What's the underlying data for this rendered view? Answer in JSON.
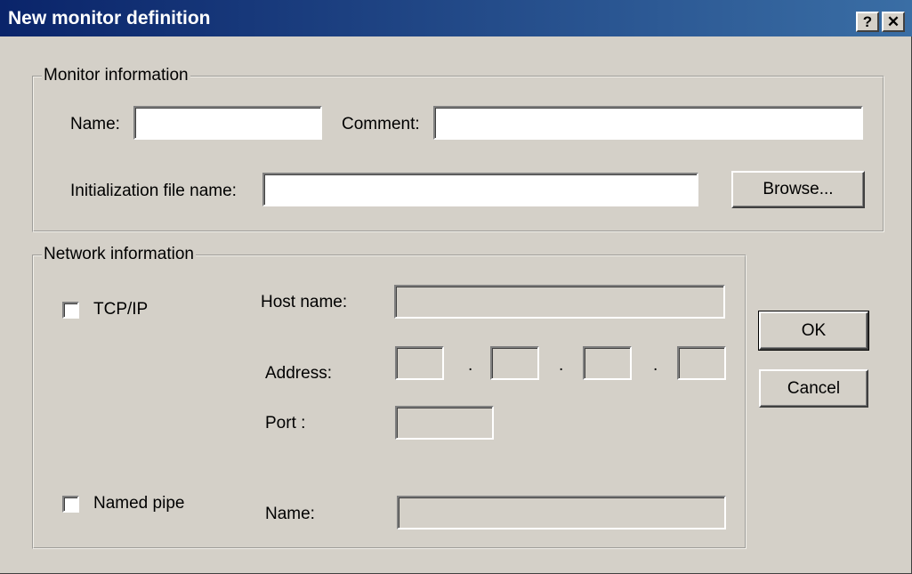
{
  "window": {
    "title": "New monitor definition",
    "help_button": "?",
    "close_button": "✕"
  },
  "monitor_info": {
    "legend": "Monitor information",
    "name_label": "Name:",
    "name_value": "",
    "comment_label": "Comment:",
    "comment_value": "",
    "init_file_label": "Initialization file name:",
    "init_file_value": "",
    "browse_button": "Browse..."
  },
  "network_info": {
    "legend": "Network information",
    "tcpip_label": "TCP/IP",
    "tcpip_checked": false,
    "host_name_label": "Host name:",
    "host_name_value": "",
    "address_label": "Address:",
    "address_octets": [
      "",
      "",
      "",
      ""
    ],
    "address_separator": ".",
    "port_label": "Port :",
    "port_value": "",
    "named_pipe_label": "Named pipe",
    "named_pipe_checked": false,
    "pipe_name_label": "Name:",
    "pipe_name_value": ""
  },
  "buttons": {
    "ok": "OK",
    "cancel": "Cancel"
  }
}
